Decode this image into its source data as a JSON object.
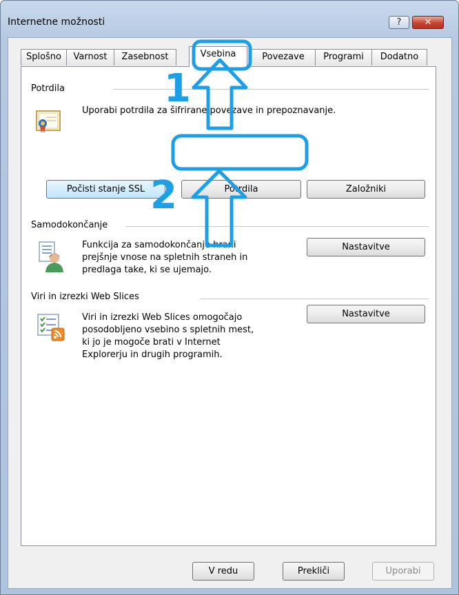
{
  "window": {
    "title": "Internetne možnosti",
    "help_glyph": "?",
    "close_glyph": "✕"
  },
  "tabs": [
    "Splošno",
    "Varnost",
    "Zasebnost",
    "Vsebina",
    "Povezave",
    "Programi",
    "Dodatno"
  ],
  "active_tab": "Vsebina",
  "certificates": {
    "label": "Potrdila",
    "description": "Uporabi potrdila za šifrirane povezave in prepoznavanje.",
    "clear_ssl": "Počisti stanje SSL",
    "certificates_button": "Potrdila",
    "publishers": "Založniki"
  },
  "autocomplete": {
    "label": "Samodokončanje",
    "description_lines": [
      "Funkcija za samodokončanje hrani",
      "prejšnje vnose na spletnih straneh in",
      "predlaga take, ki se ujemajo."
    ],
    "settings": "Nastavitve"
  },
  "feeds": {
    "label": "Viri in izrezki Web Slices",
    "description_lines": [
      "Viri in izrezki Web Slices omogočajo",
      "posodobljeno vsebino s spletnih mest,",
      "ki jo je mogoče brati v Internet",
      "Explorerju in drugih programih."
    ],
    "settings": "Nastavitve"
  },
  "footer": {
    "ok": "V redu",
    "cancel": "Prekliči",
    "apply": "Uporabi"
  },
  "annotations": {
    "step1": "1",
    "step2": "2",
    "color": "#1c9fe6"
  },
  "icons": {
    "certificate": "certificate-icon",
    "autocomplete": "autocomplete-icon",
    "feeds": "feeds-icon"
  }
}
